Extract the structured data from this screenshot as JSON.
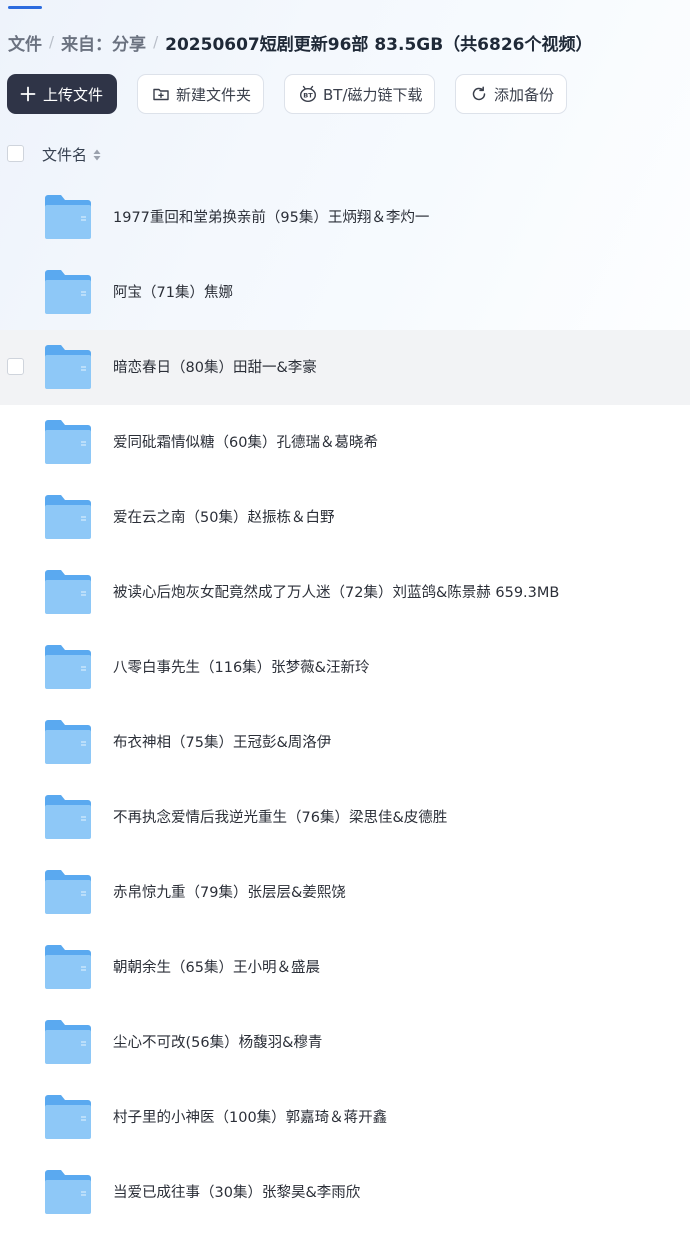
{
  "breadcrumb": {
    "items": [
      "文件",
      "来自：分享"
    ],
    "current": "20250607短剧更新96部 83.5GB（共6826个视频）"
  },
  "toolbar": {
    "upload_label": "上传文件",
    "new_folder_label": "新建文件夹",
    "bt_label": "BT/磁力链下载",
    "backup_label": "添加备份"
  },
  "list": {
    "header_name": "文件名",
    "hovered_index": 2,
    "rows": [
      {
        "name": "1977重回和堂弟换亲前（95集）王炳翔＆李灼一"
      },
      {
        "name": "阿宝（71集）焦娜"
      },
      {
        "name": "暗恋春日（80集）田甜一&李豪"
      },
      {
        "name": "爱同砒霜情似糖（60集）孔德瑞＆葛晓希"
      },
      {
        "name": "爱在云之南（50集）赵振栋＆白野"
      },
      {
        "name": "被读心后炮灰女配竟然成了万人迷（72集）刘蓝鸽&陈景赫 659.3MB"
      },
      {
        "name": "八零白事先生（116集）张梦薇&汪新玲"
      },
      {
        "name": "布衣神相（75集）王冠彭&周洛伊"
      },
      {
        "name": "不再执念爱情后我逆光重生（76集）梁思佳&皮德胜"
      },
      {
        "name": "赤帛惊九重（79集）张层层&姜熙饶"
      },
      {
        "name": "朝朝余生（65集）王小明＆盛晨"
      },
      {
        "name": "尘心不可改(56集）杨馥羽&穆青"
      },
      {
        "name": "村子里的小神医（100集）郭嘉琦＆蒋开鑫"
      },
      {
        "name": "当爱已成往事（30集）张黎昊&李雨欣"
      }
    ]
  },
  "colors": {
    "accent": "#2b6bde",
    "primary_button": "#2f3447",
    "folder_back": "#5aa9f0",
    "folder_front": "#8ec8f7",
    "hover_row": "#f2f3f5"
  },
  "icons": [
    "plus-icon",
    "folder-plus-icon",
    "bt-icon",
    "refresh-icon",
    "sort-icon",
    "folder-icon"
  ]
}
